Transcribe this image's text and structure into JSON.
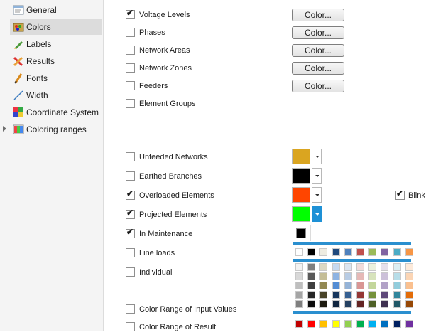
{
  "sidebar": {
    "items": [
      {
        "label": "General",
        "icon": "general-icon"
      },
      {
        "label": "Colors",
        "icon": "colors-icon",
        "selected": true
      },
      {
        "label": "Labels",
        "icon": "labels-icon"
      },
      {
        "label": "Results",
        "icon": "results-icon"
      },
      {
        "label": "Fonts",
        "icon": "fonts-icon"
      },
      {
        "label": "Width",
        "icon": "width-icon"
      },
      {
        "label": "Coordinate System",
        "icon": "coordinate-system-icon"
      },
      {
        "label": "Coloring ranges",
        "icon": "coloring-ranges-icon",
        "expandable": true
      }
    ]
  },
  "color_button_label": "Color...",
  "options": [
    {
      "label": "Voltage Levels",
      "checked": true,
      "control": "button"
    },
    {
      "label": "Phases",
      "checked": false,
      "control": "button"
    },
    {
      "label": "Network Areas",
      "checked": false,
      "control": "button"
    },
    {
      "label": "Network Zones",
      "checked": false,
      "control": "button"
    },
    {
      "label": "Feeders",
      "checked": false,
      "control": "button"
    },
    {
      "label": "Element Groups",
      "checked": false,
      "control": "none"
    },
    {
      "label": "Unfeeded Networks",
      "checked": false,
      "control": "swatch",
      "color": "#DAA520"
    },
    {
      "label": "Earthed Branches",
      "checked": false,
      "control": "swatch",
      "color": "#000000"
    },
    {
      "label": "Overloaded Elements",
      "checked": true,
      "control": "swatch",
      "color": "#FF4500"
    },
    {
      "label": "Projected Elements",
      "checked": true,
      "control": "swatch",
      "color": "#00FF00",
      "open": true
    },
    {
      "label": "In Maintenance",
      "checked": true,
      "control": "none"
    },
    {
      "label": "Line loads",
      "checked": false,
      "control": "none"
    },
    {
      "label": "Individual",
      "checked": false,
      "control": "none"
    },
    {
      "label": "Color Range of Input Values",
      "checked": false,
      "control": "none"
    },
    {
      "label": "Color Range of Result",
      "checked": false,
      "control": "none"
    }
  ],
  "blink": {
    "label": "Blink",
    "checked": true
  },
  "palette": {
    "current_color": "#000000",
    "theme_row": [
      "#FFFFFF",
      "#000000",
      "#EEECE1",
      "#1F497D",
      "#4F81BD",
      "#C0504D",
      "#9BBB59",
      "#8064A2",
      "#4BACC6",
      "#F79646"
    ],
    "theme_shades": [
      [
        "#F2F2F2",
        "#7F7F7F",
        "#DDD9C3",
        "#C6D9F0",
        "#DBE5F1",
        "#F2DCDB",
        "#EBF1DD",
        "#E5E0EC",
        "#DBEEF3",
        "#FDEADA"
      ],
      [
        "#D8D8D8",
        "#595959",
        "#C4BD97",
        "#8DB3E2",
        "#B8CCE4",
        "#E5B9B7",
        "#D7E3BC",
        "#CCC1D9",
        "#B7DDE8",
        "#FBD5B5"
      ],
      [
        "#BFBFBF",
        "#3F3F3F",
        "#938953",
        "#548DD4",
        "#95B3D7",
        "#D99694",
        "#C3D69B",
        "#B2A2C7",
        "#92CDDC",
        "#FAC08F"
      ],
      [
        "#A5A5A5",
        "#262626",
        "#494429",
        "#17365D",
        "#366092",
        "#953734",
        "#76923C",
        "#5F497A",
        "#31859B",
        "#E36C09"
      ],
      [
        "#7F7F7F",
        "#0C0C0C",
        "#1D1B10",
        "#0F243E",
        "#244061",
        "#632423",
        "#4F6128",
        "#3F3151",
        "#205867",
        "#974806"
      ]
    ],
    "standard_row": [
      "#C00000",
      "#FF0000",
      "#FFC000",
      "#FFFF00",
      "#92D050",
      "#00B050",
      "#00B0F0",
      "#0070C0",
      "#002060",
      "#7030A0"
    ]
  }
}
